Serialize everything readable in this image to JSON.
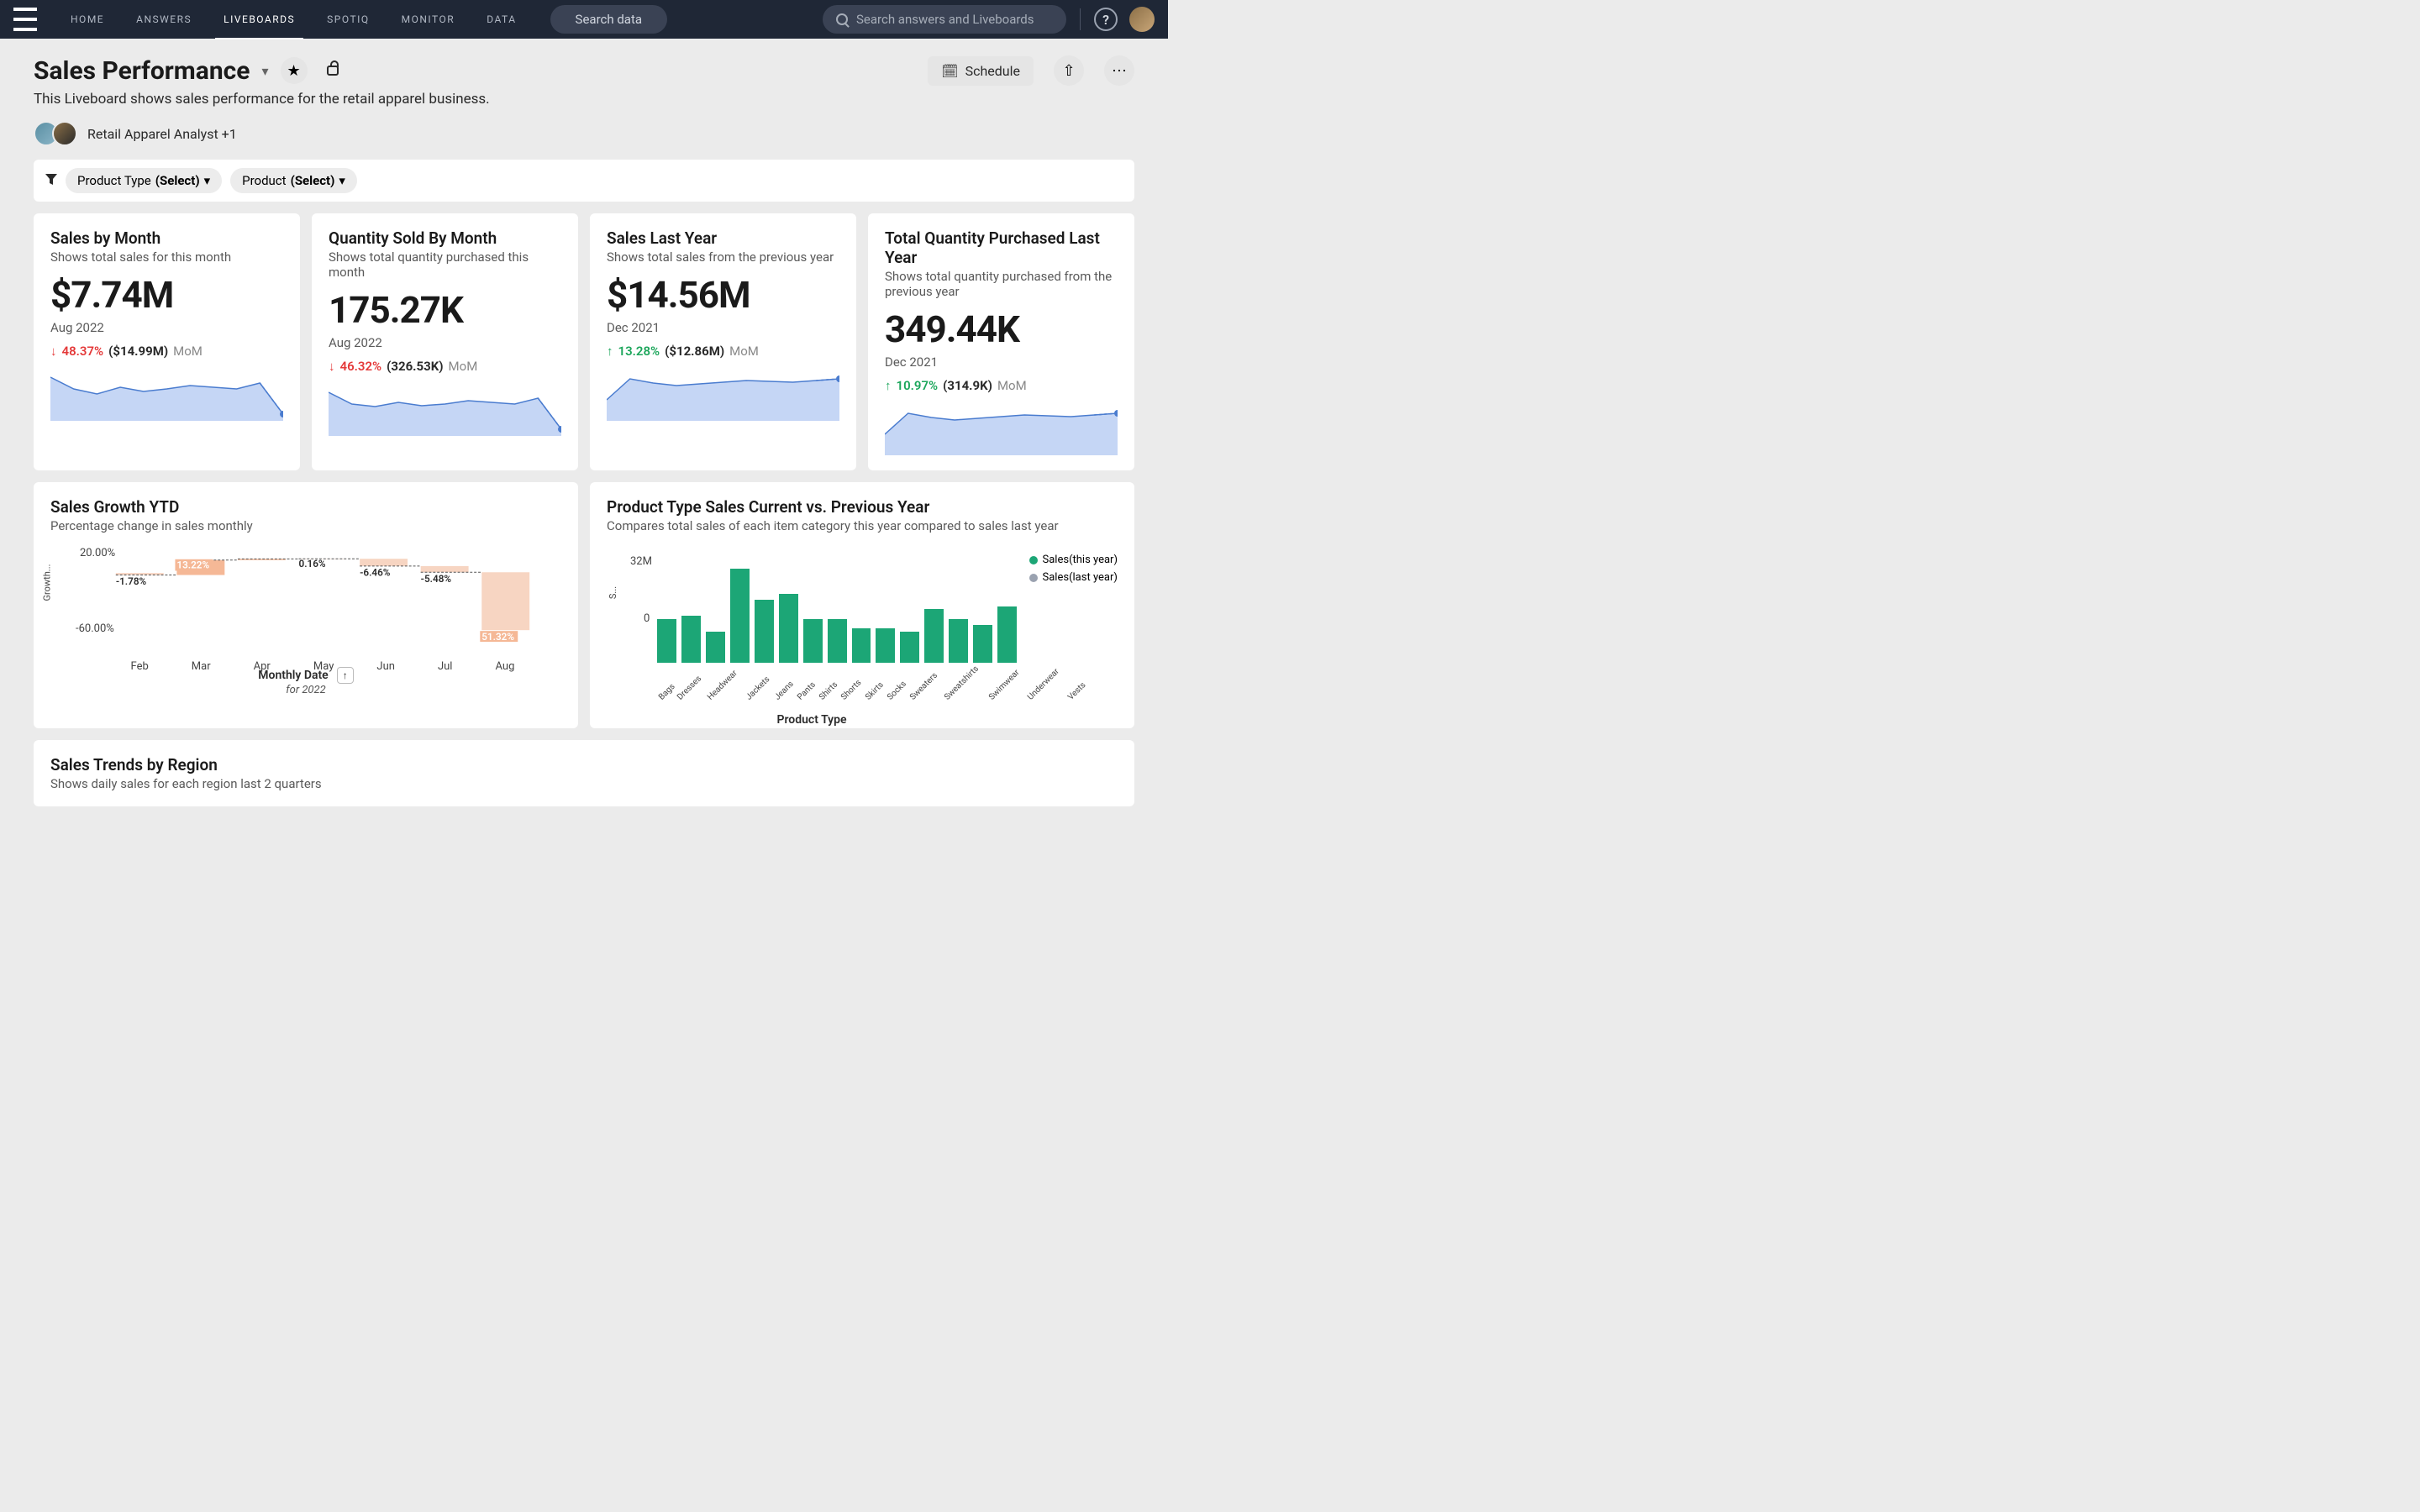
{
  "nav": {
    "items": [
      "HOME",
      "ANSWERS",
      "LIVEBOARDS",
      "SPOTIQ",
      "MONITOR",
      "DATA"
    ],
    "active": "LIVEBOARDS",
    "search_pill": "Search data",
    "search_placeholder": "Search answers and Liveboards"
  },
  "header": {
    "title": "Sales Performance",
    "subtitle": "This Liveboard shows sales performance for the retail apparel business.",
    "author_label": "Retail Apparel Analyst +1",
    "schedule_label": "Schedule"
  },
  "filters": [
    {
      "label": "Product Type",
      "value": "(Select)"
    },
    {
      "label": "Product",
      "value": "(Select)"
    }
  ],
  "kpi": [
    {
      "title": "Sales by Month",
      "sub": "Shows total sales for this month",
      "value": "$7.74M",
      "date": "Aug 2022",
      "dir": "down",
      "pct": "48.37%",
      "prev": "($14.99M)",
      "suffix": "MoM"
    },
    {
      "title": "Quantity Sold By Month",
      "sub": "Shows total quantity purchased this month",
      "value": "175.27K",
      "date": "Aug 2022",
      "dir": "down",
      "pct": "46.32%",
      "prev": "(326.53K)",
      "suffix": "MoM"
    },
    {
      "title": "Sales Last Year",
      "sub": "Shows total sales from the previous year",
      "value": "$14.56M",
      "date": "Dec 2021",
      "dir": "up",
      "pct": "13.28%",
      "prev": "($12.86M)",
      "suffix": "MoM"
    },
    {
      "title": "Total Quantity Purchased Last Year",
      "sub": "Shows total quantity purchased from the previous year",
      "value": "349.44K",
      "date": "Dec 2021",
      "dir": "up",
      "pct": "10.97%",
      "prev": "(314.9K)",
      "suffix": "MoM"
    }
  ],
  "waterfall": {
    "title": "Sales Growth YTD",
    "sub": "Percentage change in sales monthly",
    "y_label": "Growth...",
    "y_ticks": [
      "20.00%",
      "-60.00%"
    ],
    "x_title": "Monthly Date",
    "x_sub": "for 2022",
    "months": [
      "Feb",
      "Mar",
      "Apr",
      "May",
      "Jun",
      "Jul",
      "Aug"
    ]
  },
  "product_chart": {
    "title": "Product Type Sales Current vs. Previous Year",
    "sub": "Compares total sales of each item category this year compared to sales last year",
    "y_ticks": [
      "32M",
      "0"
    ],
    "y_label": "S...",
    "x_title": "Product Type",
    "legend": [
      "Sales(this year)",
      "Sales(last year)"
    ],
    "categories": [
      "Bags",
      "Dresses",
      "Headwear",
      "Jackets",
      "Jeans",
      "Pants",
      "Shirts",
      "Shorts",
      "Skirts",
      "Socks",
      "Sweaters",
      "Sweatshirts",
      "Swimwear",
      "Underwear",
      "Vests"
    ]
  },
  "trends": {
    "title": "Sales Trends by Region",
    "sub": "Shows daily sales for each region last 2 quarters"
  },
  "chart_data": {
    "kpi_sparks": [
      {
        "points": [
          8,
          22,
          28,
          20,
          25,
          22,
          18,
          20,
          22,
          15,
          52
        ],
        "type": "area"
      },
      {
        "points": [
          8,
          22,
          25,
          20,
          24,
          22,
          18,
          20,
          22,
          15,
          52
        ],
        "type": "area"
      },
      {
        "points": [
          35,
          10,
          15,
          18,
          16,
          14,
          12,
          13,
          14,
          12,
          10
        ],
        "type": "area"
      },
      {
        "points": [
          35,
          10,
          15,
          18,
          16,
          14,
          12,
          13,
          14,
          12,
          10
        ],
        "type": "area"
      }
    ],
    "waterfall": {
      "type": "bar",
      "categories": [
        "Feb",
        "Mar",
        "Apr",
        "May",
        "Jun",
        "Jul",
        "Aug"
      ],
      "values": [
        -1.78,
        13.22,
        1.0,
        0.16,
        -6.46,
        -5.48,
        -51.32
      ],
      "labels": [
        "-1.78%",
        "13.22%",
        "",
        "0.16%",
        "-6.46%",
        "-5.48%",
        "51.32%"
      ],
      "ylim": [
        -60,
        20
      ],
      "xlabel": "Monthly Date",
      "ylabel": "Growth"
    },
    "product_bars": {
      "type": "bar",
      "categories": [
        "Bags",
        "Dresses",
        "Headwear",
        "Jackets",
        "Jeans",
        "Pants",
        "Shirts",
        "Shorts",
        "Skirts",
        "Socks",
        "Sweaters",
        "Sweatshirts",
        "Swimwear",
        "Underwear",
        "Vests"
      ],
      "series": [
        {
          "name": "Sales(this year)",
          "values": [
            14,
            15,
            10,
            30,
            20,
            22,
            14,
            14,
            11,
            11,
            10,
            17,
            14,
            12,
            18
          ]
        }
      ],
      "ylim": [
        0,
        32
      ],
      "ylabel": "Sales",
      "xlabel": "Product Type"
    }
  },
  "colors": {
    "spark_fill": "#c5d6f5",
    "spark_line": "#4a7ccf",
    "bar_fill": "#1ca676",
    "waterfall_up": "#f5b896",
    "waterfall_down": "#f7d5c2"
  }
}
